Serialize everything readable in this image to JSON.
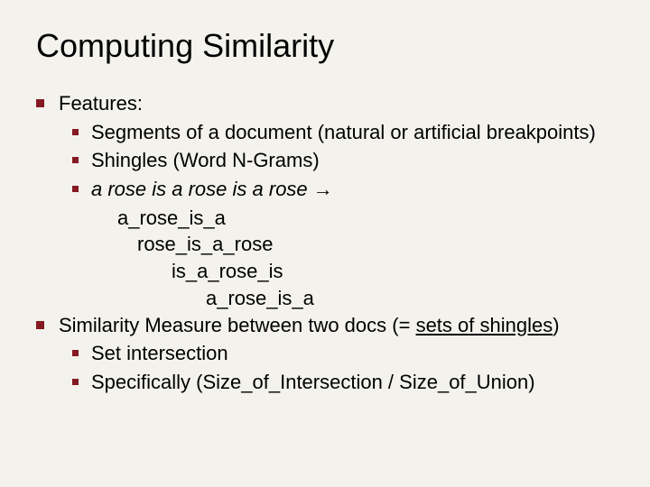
{
  "title": "Computing Similarity",
  "bullets": {
    "features": "Features:",
    "segments": "Segments of a document (natural or artificial breakpoints)",
    "shingles": "Shingles (Word N-Grams)",
    "rose_example": "a rose is a rose is a rose →",
    "rose1": "a_rose_is_a",
    "rose2": "rose_is_a_rose",
    "rose3": "is_a_rose_is",
    "rose4": "a_rose_is_a",
    "similarity_pre": "Similarity Measure between two docs (= ",
    "similarity_under": "sets of shingles",
    "similarity_post": ")",
    "set_intersection": "Set intersection",
    "specifically": "Specifically (Size_of_Intersection / Size_of_Union)"
  }
}
